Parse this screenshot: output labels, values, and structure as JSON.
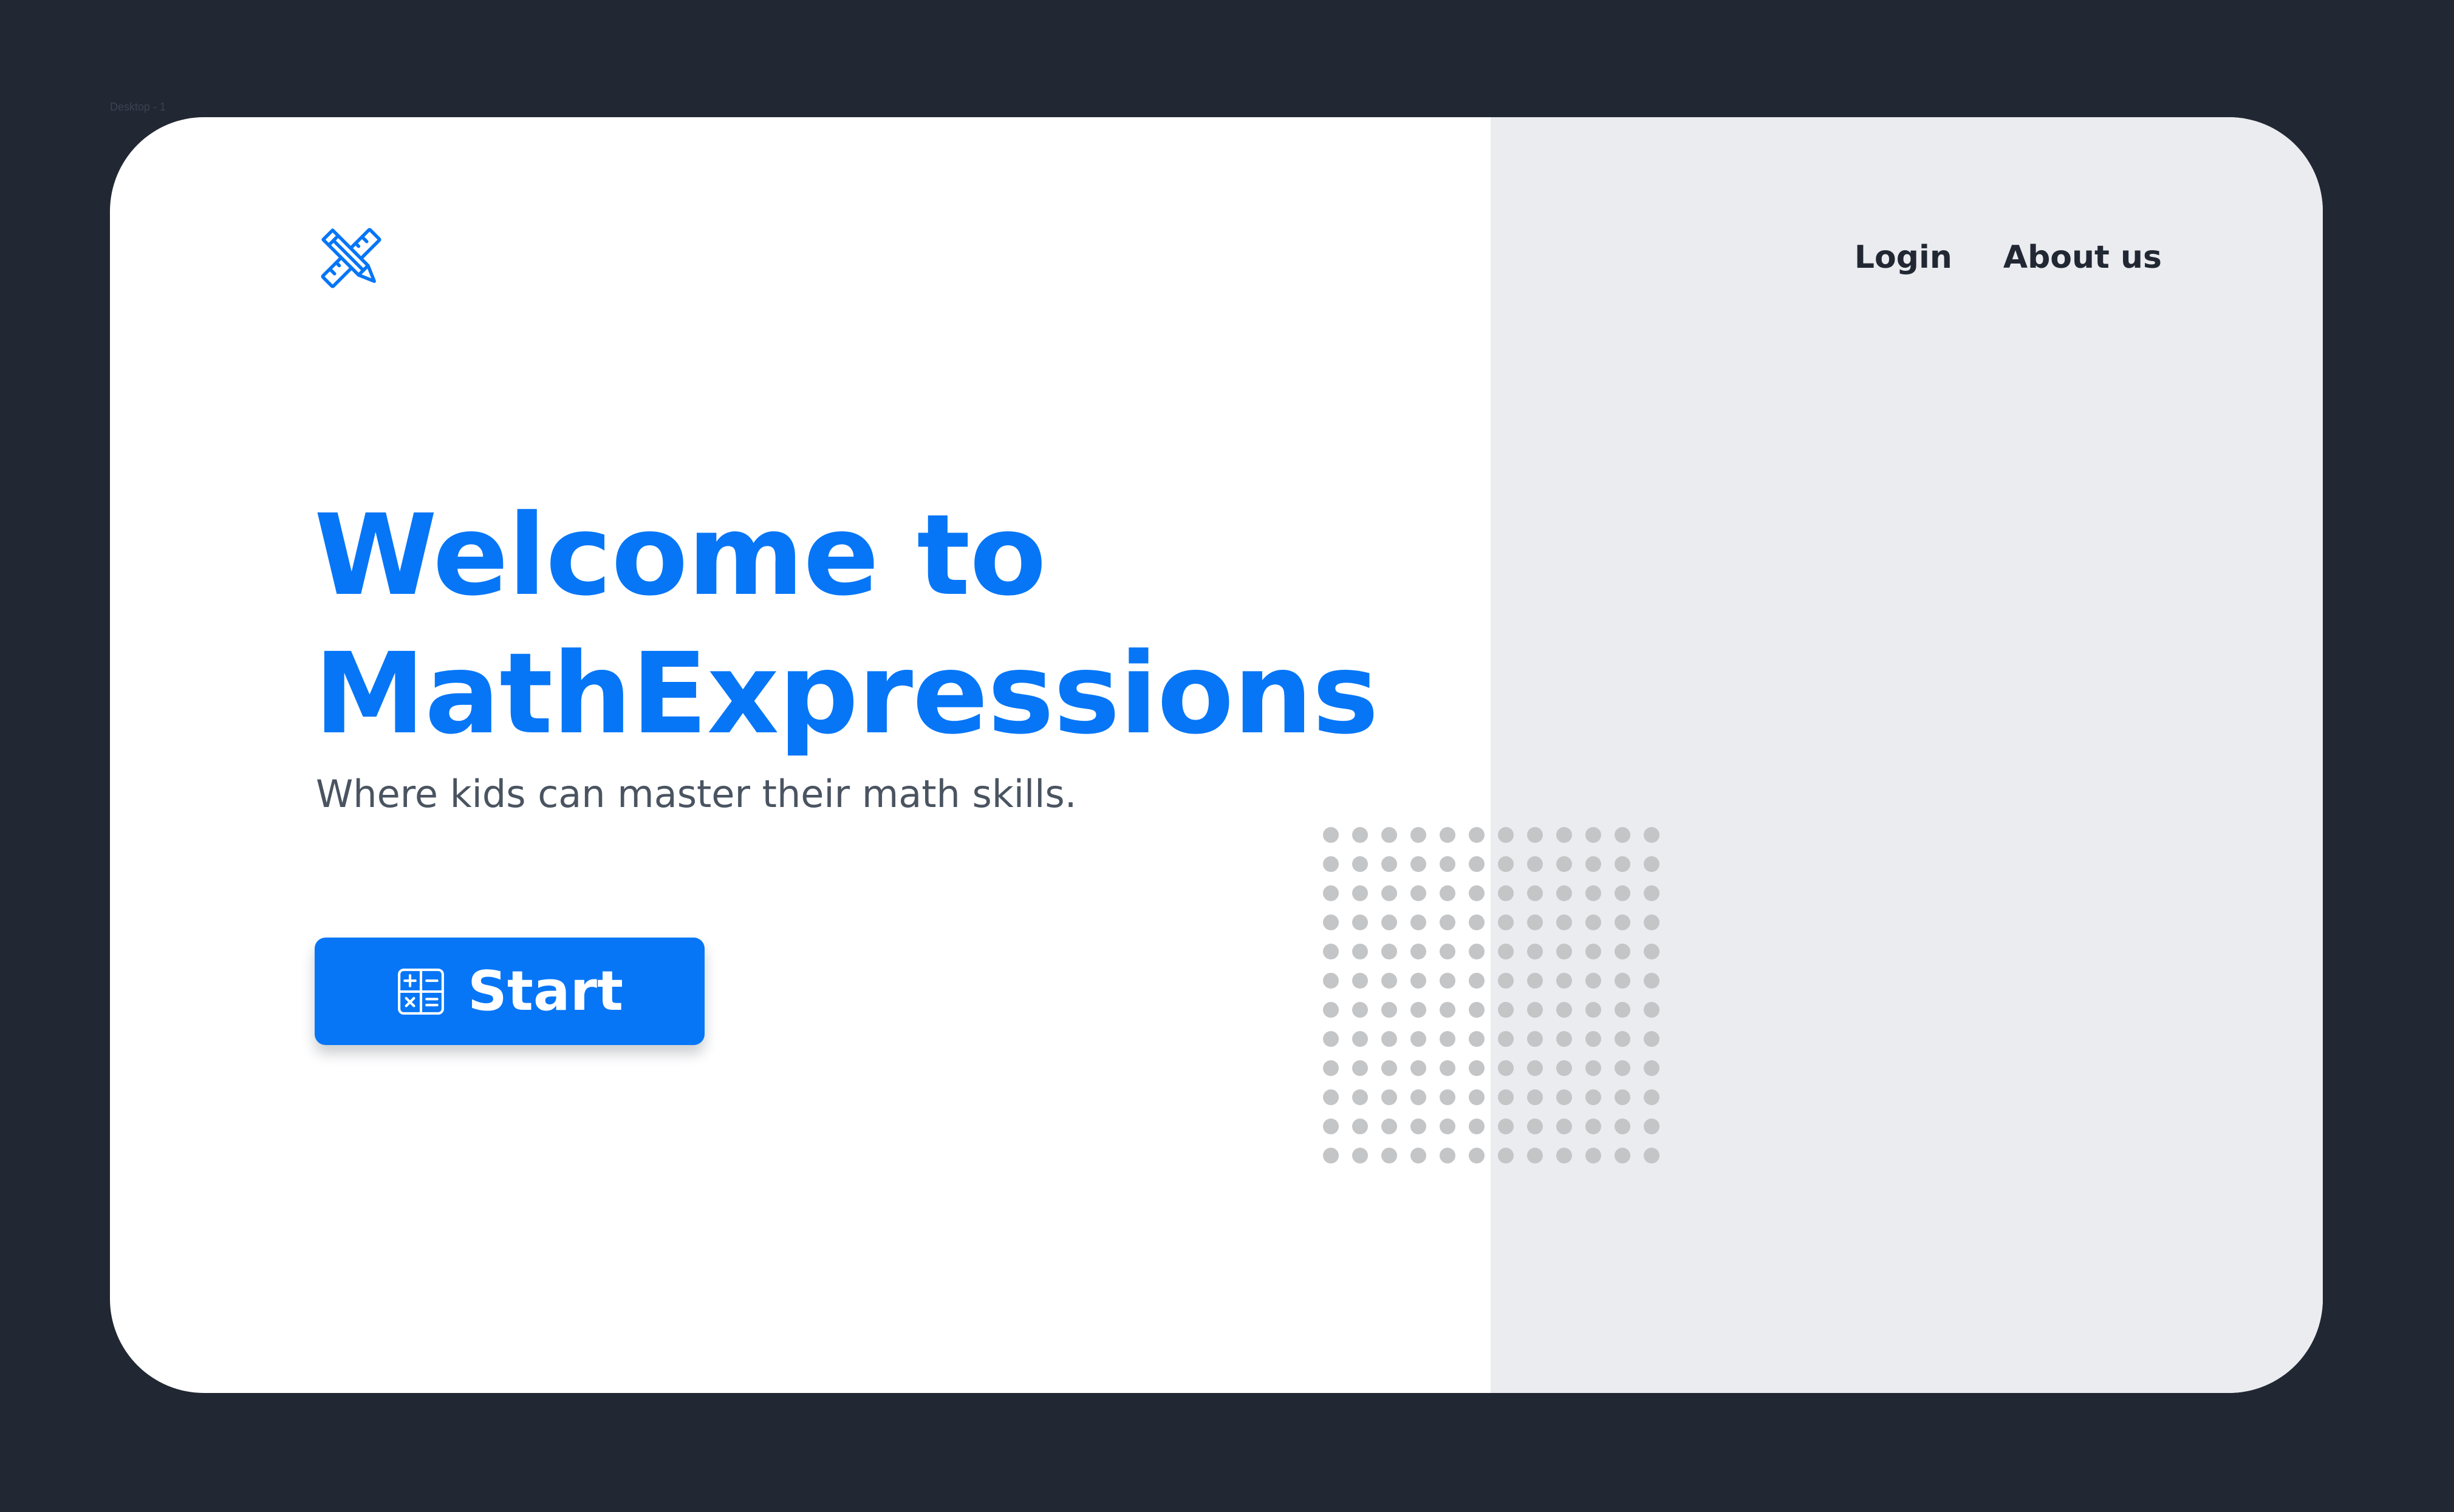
{
  "frame": {
    "label": "Desktop - 1"
  },
  "logo": {
    "icon": "pencil-ruler-icon"
  },
  "nav": {
    "items": [
      {
        "label": "Login"
      },
      {
        "label": "About us"
      }
    ]
  },
  "hero": {
    "title_line1": "Welcome to",
    "title_line2": "MathExpressions",
    "subtitle": "Where kids can master their math skills.",
    "start_button": {
      "label": "Start",
      "icon": "calculator-icon"
    }
  },
  "decoration": {
    "dot_grid_rows": 12,
    "dot_grid_cols": 12
  },
  "colors": {
    "page_background": "#212833",
    "card_background": "#ffffff",
    "panel_background": "#ebecf0",
    "accent": "#0676f7",
    "nav_text": "#212833",
    "subtitle_text": "#4a5461",
    "dot": "#c4c5c7"
  }
}
